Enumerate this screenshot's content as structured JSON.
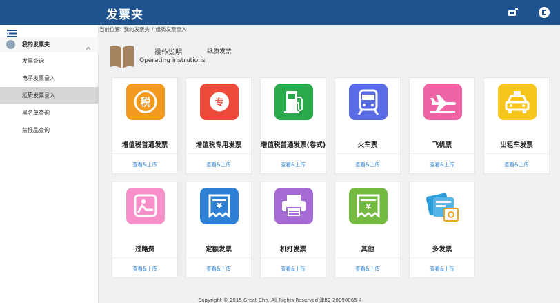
{
  "app": {
    "title": "发票夹"
  },
  "sidebar": {
    "group_label": "我的发票夹",
    "items": [
      {
        "label": "发票查询"
      },
      {
        "label": "电子发票录入"
      },
      {
        "label": "纸质发票录入"
      },
      {
        "label": "黑名单查询"
      },
      {
        "label": "禁报品查询"
      }
    ]
  },
  "breadcrumb": {
    "prefix": "当前位置:",
    "level1": "我的发票夹",
    "sep": "/",
    "level2": "纸质发票录入"
  },
  "help": {
    "title": "操作说明",
    "subtitle": "Operating instrutions",
    "tab2": "纸质发票"
  },
  "cards": [
    {
      "title": "增值税普通发票",
      "action": "查看&上传",
      "color": "#f39a1e",
      "icon": "tax-icon"
    },
    {
      "title": "增值税专用发票",
      "action": "查看&上传",
      "color": "#ee4a3c",
      "icon": "special-icon"
    },
    {
      "title": "增值税普通发票(卷式)",
      "action": "查看&上传",
      "color": "#2aa94d",
      "icon": "fuel-pump-icon"
    },
    {
      "title": "火车票",
      "action": "查看&上传",
      "color": "#5a6ce4",
      "icon": "train-icon"
    },
    {
      "title": "飞机票",
      "action": "查看&上传",
      "color": "#f064a6",
      "icon": "airplane-icon"
    },
    {
      "title": "出租车发票",
      "action": "查看&上传",
      "color": "#f8c51d",
      "icon": "taxi-icon"
    },
    {
      "title": "过路费",
      "action": "查看&上传",
      "color": "#f78fc9",
      "icon": "toll-icon"
    },
    {
      "title": "定额发票",
      "action": "查看&上传",
      "color": "#2e80d4",
      "icon": "quota-receipt-icon"
    },
    {
      "title": "机打发票",
      "action": "查看&上传",
      "color": "#a66ad4",
      "icon": "printer-icon"
    },
    {
      "title": "其他",
      "action": "查看&上传",
      "color": "#74b940",
      "icon": "other-receipt-icon"
    },
    {
      "title": "多发票",
      "action": "查看&上传",
      "color": "#2a9ad8",
      "icon": "multi-invoice-icon"
    }
  ],
  "footer": {
    "text": "Copyright © 2015 Great-Chn, All Rights Reserved 津B2-20090065-4"
  }
}
